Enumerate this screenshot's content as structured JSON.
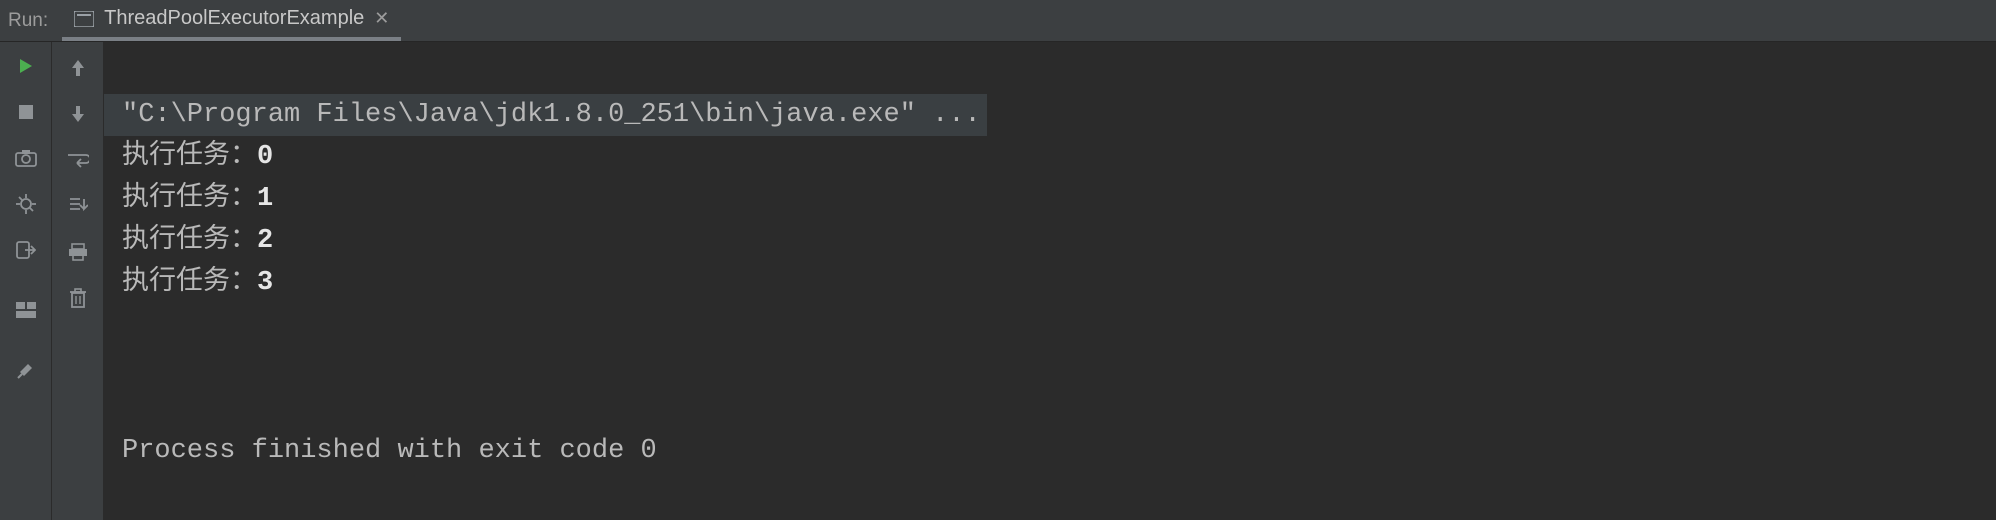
{
  "header": {
    "run_label": "Run:",
    "tab_name": "ThreadPoolExecutorExample"
  },
  "console": {
    "command": "\"C:\\Program Files\\Java\\jdk1.8.0_251\\bin\\java.exe\" ...",
    "task_prefix": "执行任务：",
    "tasks": [
      "0",
      "1",
      "2",
      "3"
    ],
    "finish": "Process finished with exit code 0"
  }
}
